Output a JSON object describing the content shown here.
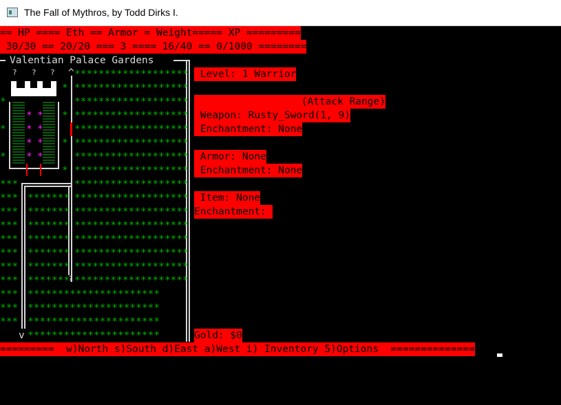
{
  "window": {
    "title": "The Fall of Mythros, by Todd Dirks I."
  },
  "stats": {
    "header_line": "== HP ==== Eth == Armor = Weight===== XP =========",
    "values_line": " 30/30 == 20/20 === 3 ==== 16/40 == 0/1000 ========"
  },
  "map": {
    "title": "Valentian Palace Gardens",
    "exit_north": "^",
    "exit_south": "v",
    "item_marker": "?",
    "tower_markers": [
      "?",
      "?",
      "?"
    ],
    "row_garden": "*******************",
    "row_garden_wide": "**********************"
  },
  "panel": {
    "level": " Level: 1 Warrior",
    "attack_range": "(Attack Range)",
    "weapon": " Weapon: Rusty_Sword(1, 9)",
    "weapon_enchant": " Enchantment: None",
    "armor": " Armor: None",
    "armor_enchant": " Enchantment: None",
    "item": " Item: None",
    "item_enchant": "Enchantment: ",
    "gold": "Gold: $0"
  },
  "controls": {
    "line": "=========  w)North s)South d)East a)West i) Inventory 5)Options  =============="
  },
  "colors": {
    "accent": "#ff0000",
    "garden": "#00b000",
    "wall": "#d8d8d8",
    "flower": "#ff20ff"
  }
}
